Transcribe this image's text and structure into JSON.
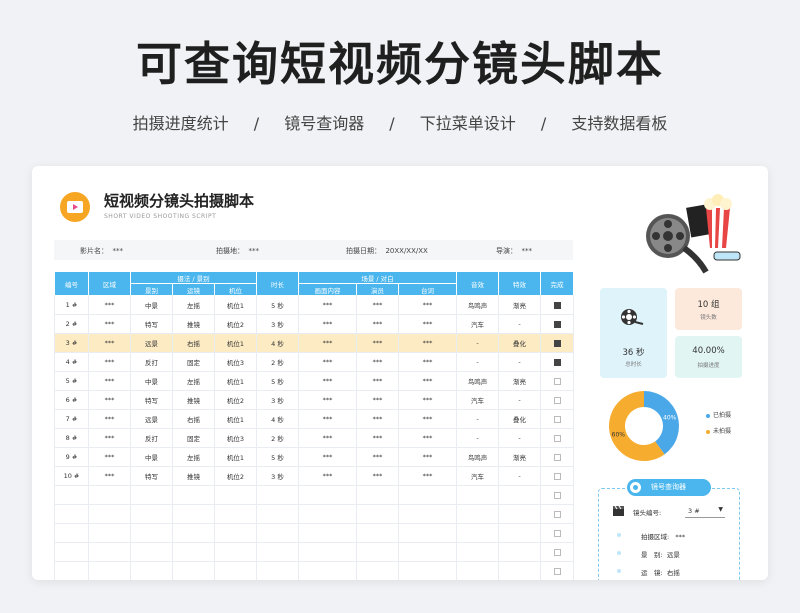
{
  "hero": {
    "title": "可查询短视频分镜头脚本",
    "features": [
      "拍摄进度统计",
      "镜号查询器",
      "下拉菜单设计",
      "支持数据看板"
    ],
    "separator": "/"
  },
  "doc": {
    "title": "短视频分镜头拍摄脚本",
    "subtitle": "SHORT VIDEO SHOOTING SCRIPT",
    "logo_icon": "video-play-icon"
  },
  "meta": [
    {
      "label": "影片名：",
      "value": "***"
    },
    {
      "label": "拍摄地：",
      "value": "***"
    },
    {
      "label": "拍摄日期：",
      "value": "20XX/XX/XX"
    },
    {
      "label": "导演：",
      "value": "***"
    }
  ],
  "table": {
    "groups": [
      "摄法 / 景别",
      "场景 / 对白"
    ],
    "headers": {
      "id": "编号",
      "area": "区域",
      "shot": "景别",
      "move": "运镜",
      "pos": "机位",
      "dur": "时长",
      "content": "画面内容",
      "actor": "演员",
      "line": "台词",
      "sound": "音效",
      "effect": "特效",
      "done": "完成"
    },
    "rows": [
      {
        "id": "1 #",
        "area": "***",
        "shot": "中景",
        "move": "左摇",
        "pos": "机位1",
        "dur": "5 秒",
        "content": "***",
        "actor": "***",
        "line": "***",
        "sound": "鸟鸣声",
        "effect": "渐亮",
        "done": true,
        "hl": false
      },
      {
        "id": "2 #",
        "area": "***",
        "shot": "特写",
        "move": "推镜",
        "pos": "机位2",
        "dur": "3 秒",
        "content": "***",
        "actor": "***",
        "line": "***",
        "sound": "汽车",
        "effect": "-",
        "done": true,
        "hl": false
      },
      {
        "id": "3 #",
        "area": "***",
        "shot": "远景",
        "move": "右摇",
        "pos": "机位1",
        "dur": "4 秒",
        "content": "***",
        "actor": "***",
        "line": "***",
        "sound": "-",
        "effect": "叠化",
        "done": true,
        "hl": true
      },
      {
        "id": "4 #",
        "area": "***",
        "shot": "反打",
        "move": "固定",
        "pos": "机位3",
        "dur": "2 秒",
        "content": "***",
        "actor": "***",
        "line": "***",
        "sound": "-",
        "effect": "-",
        "done": true,
        "hl": false
      },
      {
        "id": "5 #",
        "area": "***",
        "shot": "中景",
        "move": "左摇",
        "pos": "机位1",
        "dur": "5 秒",
        "content": "***",
        "actor": "***",
        "line": "***",
        "sound": "鸟鸣声",
        "effect": "渐亮",
        "done": false,
        "hl": false
      },
      {
        "id": "6 #",
        "area": "***",
        "shot": "特写",
        "move": "推镜",
        "pos": "机位2",
        "dur": "3 秒",
        "content": "***",
        "actor": "***",
        "line": "***",
        "sound": "汽车",
        "effect": "-",
        "done": false,
        "hl": false
      },
      {
        "id": "7 #",
        "area": "***",
        "shot": "远景",
        "move": "右摇",
        "pos": "机位1",
        "dur": "4 秒",
        "content": "***",
        "actor": "***",
        "line": "***",
        "sound": "-",
        "effect": "叠化",
        "done": false,
        "hl": false
      },
      {
        "id": "8 #",
        "area": "***",
        "shot": "反打",
        "move": "固定",
        "pos": "机位3",
        "dur": "2 秒",
        "content": "***",
        "actor": "***",
        "line": "***",
        "sound": "-",
        "effect": "-",
        "done": false,
        "hl": false
      },
      {
        "id": "9 #",
        "area": "***",
        "shot": "中景",
        "move": "左摇",
        "pos": "机位1",
        "dur": "5 秒",
        "content": "***",
        "actor": "***",
        "line": "***",
        "sound": "鸟鸣声",
        "effect": "渐亮",
        "done": false,
        "hl": false
      },
      {
        "id": "10 #",
        "area": "***",
        "shot": "特写",
        "move": "推镜",
        "pos": "机位2",
        "dur": "3 秒",
        "content": "***",
        "actor": "***",
        "line": "***",
        "sound": "汽车",
        "effect": "-",
        "done": false,
        "hl": false
      }
    ],
    "empty_rows": 5
  },
  "stats": {
    "duration_value": "36 秒",
    "duration_label": "总时长",
    "count_value": "10 组",
    "count_label": "镜头数",
    "progress_value": "40.00%",
    "progress_label": "拍摄进度",
    "film_icon": "film-reel-icon"
  },
  "chart_data": {
    "type": "pie",
    "donut": true,
    "categories": [
      "已拍摄",
      "未拍摄"
    ],
    "values": [
      40,
      60
    ],
    "labels": [
      "40%",
      "60%"
    ],
    "colors": [
      "#4aa8e8",
      "#f6ad2f"
    ],
    "legend_placement": "right"
  },
  "finder": {
    "title": "镜号查询器",
    "select_label": "镜头编号:",
    "select_value": "3 #",
    "clapper_icon": "clapperboard-icon",
    "fields": [
      {
        "label": "拍摄区域:",
        "value": "***"
      },
      {
        "label": "景　别:",
        "value": "远景"
      },
      {
        "label": "运　镜:",
        "value": "右摇"
      }
    ]
  },
  "colors": {
    "header": "#4bb6ee",
    "highlight": "#fdebc4",
    "pink_card": "#fde9dc",
    "blue_card": "#dff3fb",
    "mint_card": "#e1f5f3"
  }
}
